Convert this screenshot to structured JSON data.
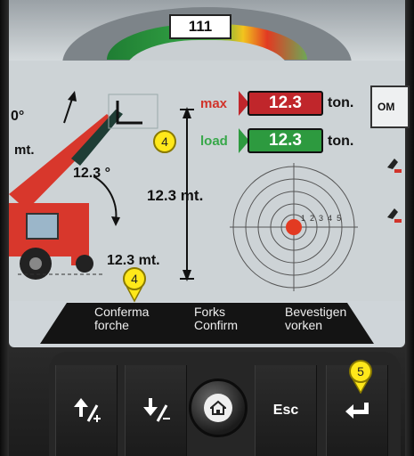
{
  "header": {
    "counter": "111"
  },
  "load_panel": {
    "max_label": "max",
    "max_value": "12.3",
    "max_unit": "ton.",
    "load_label": "load",
    "load_value": "12.3",
    "load_unit": "ton.",
    "mode_button": "OM"
  },
  "boom_diagram": {
    "height": "12.3 mt.",
    "angle": "12.3 °",
    "reach": "12.3 mt.",
    "left_reach": "mt.",
    "left_angle": "0°"
  },
  "target": {
    "rings": [
      "1",
      "2",
      "3",
      "4",
      "5"
    ]
  },
  "markers": {
    "marker_boom": "4",
    "marker_label": "4",
    "marker_enter": "5"
  },
  "labels": {
    "forks_it": "Conferma forche",
    "forks_en": "Forks Confirm",
    "forks_nl": "Bevestigen vorken"
  },
  "controls": {
    "esc": "Esc",
    "up_icon": "arrow-up-plus-icon",
    "down_icon": "arrow-down-minus-icon",
    "home_icon": "home-icon",
    "enter_icon": "enter-arrow-icon"
  },
  "colors": {
    "max": "#c0262b",
    "load": "#2d9a3f",
    "marker": "#ffe81a",
    "panel": "#cdd3d6"
  }
}
